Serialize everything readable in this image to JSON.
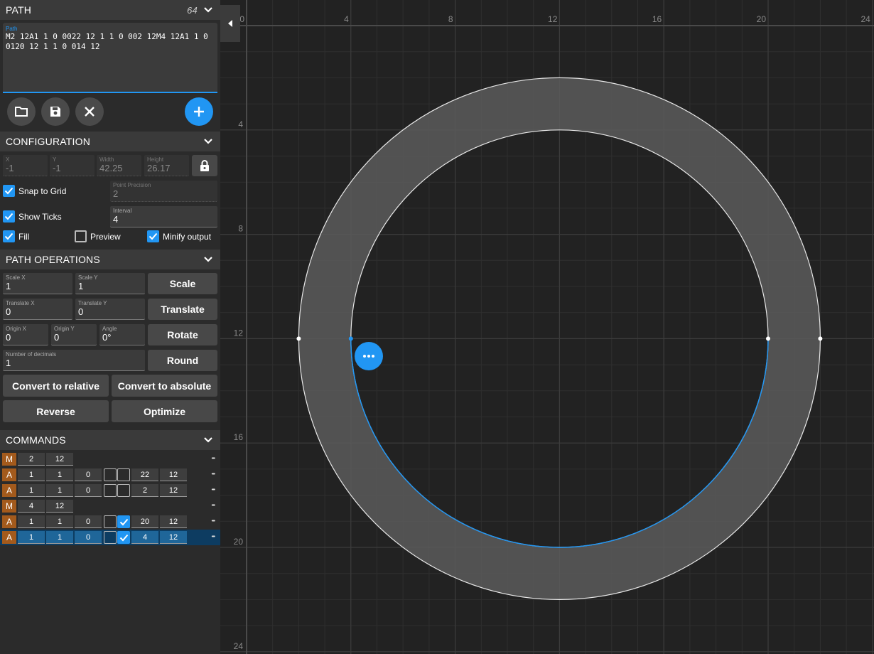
{
  "sidebar": {
    "path_section": {
      "title": "PATH",
      "count": "64",
      "path_label": "Path",
      "path_value": "M2 12A1 1 0 0022 12 1 1 0 002 12M4 12A1 1 0 0120 12 1 1 0 014 12"
    },
    "configuration": {
      "title": "CONFIGURATION",
      "x": {
        "label": "X",
        "value": "-1"
      },
      "y": {
        "label": "Y",
        "value": "-1"
      },
      "width": {
        "label": "Width",
        "value": "42.25"
      },
      "height": {
        "label": "Height",
        "value": "26.17"
      },
      "snap_to_grid": "Snap to Grid",
      "show_ticks": "Show Ticks",
      "point_precision": {
        "label": "Point Precision",
        "value": "2"
      },
      "interval": {
        "label": "Interval",
        "value": "4"
      },
      "fill": "Fill",
      "preview": "Preview",
      "minify_output": "Minify output"
    },
    "path_operations": {
      "title": "PATH OPERATIONS",
      "scale_x": {
        "label": "Scale X",
        "value": "1"
      },
      "scale_y": {
        "label": "Scale Y",
        "value": "1"
      },
      "scale_btn": "Scale",
      "translate_x": {
        "label": "Translate X",
        "value": "0"
      },
      "translate_y": {
        "label": "Translate Y",
        "value": "0"
      },
      "translate_btn": "Translate",
      "origin_x": {
        "label": "Origin X",
        "value": "0"
      },
      "origin_y": {
        "label": "Origin Y",
        "value": "0"
      },
      "angle": {
        "label": "Angle",
        "value": "0°"
      },
      "rotate_btn": "Rotate",
      "decimals": {
        "label": "Number of decimals",
        "value": "1"
      },
      "round_btn": "Round",
      "convert_relative": "Convert to relative",
      "convert_absolute": "Convert to absolute",
      "reverse": "Reverse",
      "optimize": "Optimize"
    },
    "commands": {
      "title": "COMMANDS",
      "rows": [
        {
          "type": "M",
          "v": [
            "2",
            "12"
          ]
        },
        {
          "type": "A",
          "v": [
            "1",
            "1",
            "0",
            "22",
            "12"
          ],
          "flags": [
            false,
            false
          ]
        },
        {
          "type": "A",
          "v": [
            "1",
            "1",
            "0",
            "2",
            "12"
          ],
          "flags": [
            false,
            false
          ]
        },
        {
          "type": "M",
          "v": [
            "4",
            "12"
          ]
        },
        {
          "type": "A",
          "v": [
            "1",
            "1",
            "0",
            "20",
            "12"
          ],
          "flags": [
            false,
            true
          ]
        },
        {
          "type": "A",
          "v": [
            "1",
            "1",
            "0",
            "4",
            "12"
          ],
          "flags": [
            false,
            true
          ],
          "selected": true
        }
      ]
    }
  },
  "canvas": {
    "x_ticks": [
      "0",
      "4",
      "8",
      "12",
      "16",
      "20",
      "24"
    ],
    "y_ticks": [
      "4",
      "8",
      "12",
      "16",
      "20",
      "24"
    ],
    "colors": {
      "selected_segment": "#2196f3",
      "fill": "#5a5a5a",
      "background": "#222222",
      "grid": "#2f2f2f"
    }
  }
}
